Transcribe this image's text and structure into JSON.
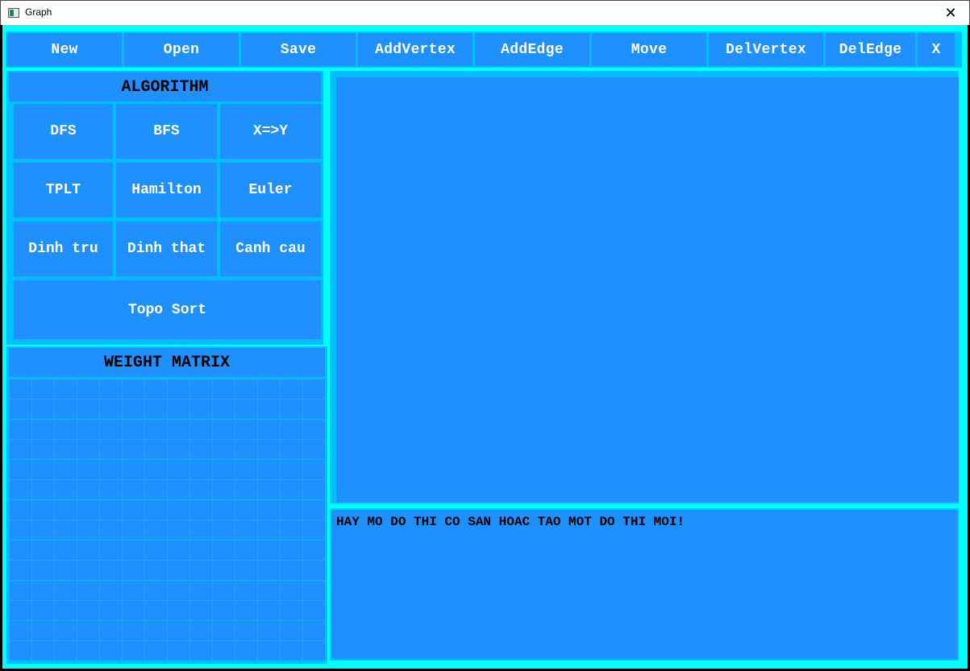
{
  "window": {
    "title": "Graph",
    "close_symbol": "✕"
  },
  "toolbar": {
    "buttons": [
      "New",
      "Open",
      "Save",
      "AddVertex",
      "AddEdge",
      "Move",
      "DelVertex",
      "DelEdge",
      "X"
    ]
  },
  "algorithm": {
    "title": "ALGORITHM",
    "buttons": [
      "DFS",
      "BFS",
      "X=>Y",
      "TPLT",
      "Hamilton",
      "Euler",
      "Dinh tru",
      "Dinh that",
      "Canh cau",
      "Topo Sort"
    ]
  },
  "matrix": {
    "title": "WEIGHT MATRIX"
  },
  "message": {
    "text": "HAY MO DO THI CO SAN HOAC TAO MOT DO THI MOI!"
  },
  "colors": {
    "panel_blue": "#1e90ff",
    "border_cyan": "#00ffff",
    "frame_cyan": "#00bfff"
  }
}
